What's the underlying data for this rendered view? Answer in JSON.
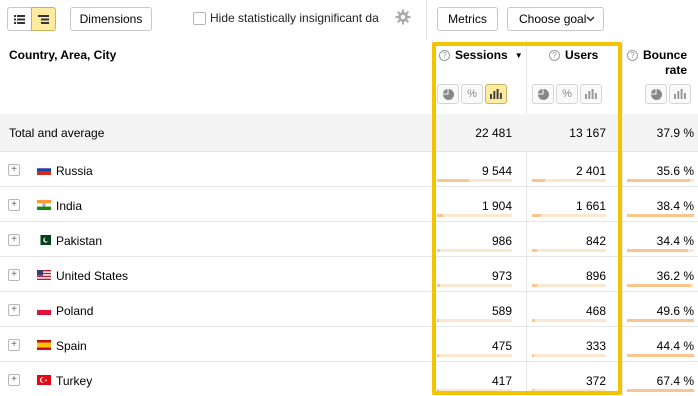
{
  "toolbar": {
    "dimensions_label": "Dimensions",
    "hide_label": "Hide statistically insignificant da",
    "metrics_label": "Metrics",
    "goal_label": "Choose goal"
  },
  "table": {
    "dimension_header": "Country, Area, City",
    "columns": [
      {
        "name": "Sessions",
        "sorted": true
      },
      {
        "name": "Users",
        "sorted": false
      },
      {
        "name": "Bounce rate",
        "line1": "Bounce",
        "line2": "rate",
        "sorted": false
      }
    ],
    "total": {
      "label": "Total and average",
      "sessions": "22 481",
      "users": "13 167",
      "bounce": "37.9 %"
    },
    "rows": [
      {
        "country": "Russia",
        "flag": "ru",
        "sessions": "9 544",
        "users": "2 401",
        "bounce": "35.6 %",
        "sessions_share": 0.42,
        "users_share": 0.18,
        "bounce_share": 0.94
      },
      {
        "country": "India",
        "flag": "in",
        "sessions": "1 904",
        "users": "1 661",
        "bounce": "38.4 %",
        "sessions_share": 0.085,
        "users_share": 0.126,
        "bounce_share": 1.0
      },
      {
        "country": "Pakistan",
        "flag": "pk",
        "sessions": "986",
        "users": "842",
        "bounce": "34.4 %",
        "sessions_share": 0.044,
        "users_share": 0.064,
        "bounce_share": 0.91
      },
      {
        "country": "United States",
        "flag": "us",
        "sessions": "973",
        "users": "896",
        "bounce": "36.2 %",
        "sessions_share": 0.043,
        "users_share": 0.068,
        "bounce_share": 0.95
      },
      {
        "country": "Poland",
        "flag": "pl",
        "sessions": "589",
        "users": "468",
        "bounce": "49.6 %",
        "sessions_share": 0.026,
        "users_share": 0.036,
        "bounce_share": 1.0
      },
      {
        "country": "Spain",
        "flag": "es",
        "sessions": "475",
        "users": "333",
        "bounce": "44.4 %",
        "sessions_share": 0.021,
        "users_share": 0.025,
        "bounce_share": 1.0
      },
      {
        "country": "Turkey",
        "flag": "tr",
        "sessions": "417",
        "users": "372",
        "bounce": "67.4 %",
        "sessions_share": 0.019,
        "users_share": 0.028,
        "bounce_share": 1.0
      }
    ]
  },
  "colors": {
    "highlight": "#f5c400",
    "bar_fill": "#f9c690",
    "bar_track": "#fbe6cf",
    "toggle_active": "#ffeba0"
  }
}
